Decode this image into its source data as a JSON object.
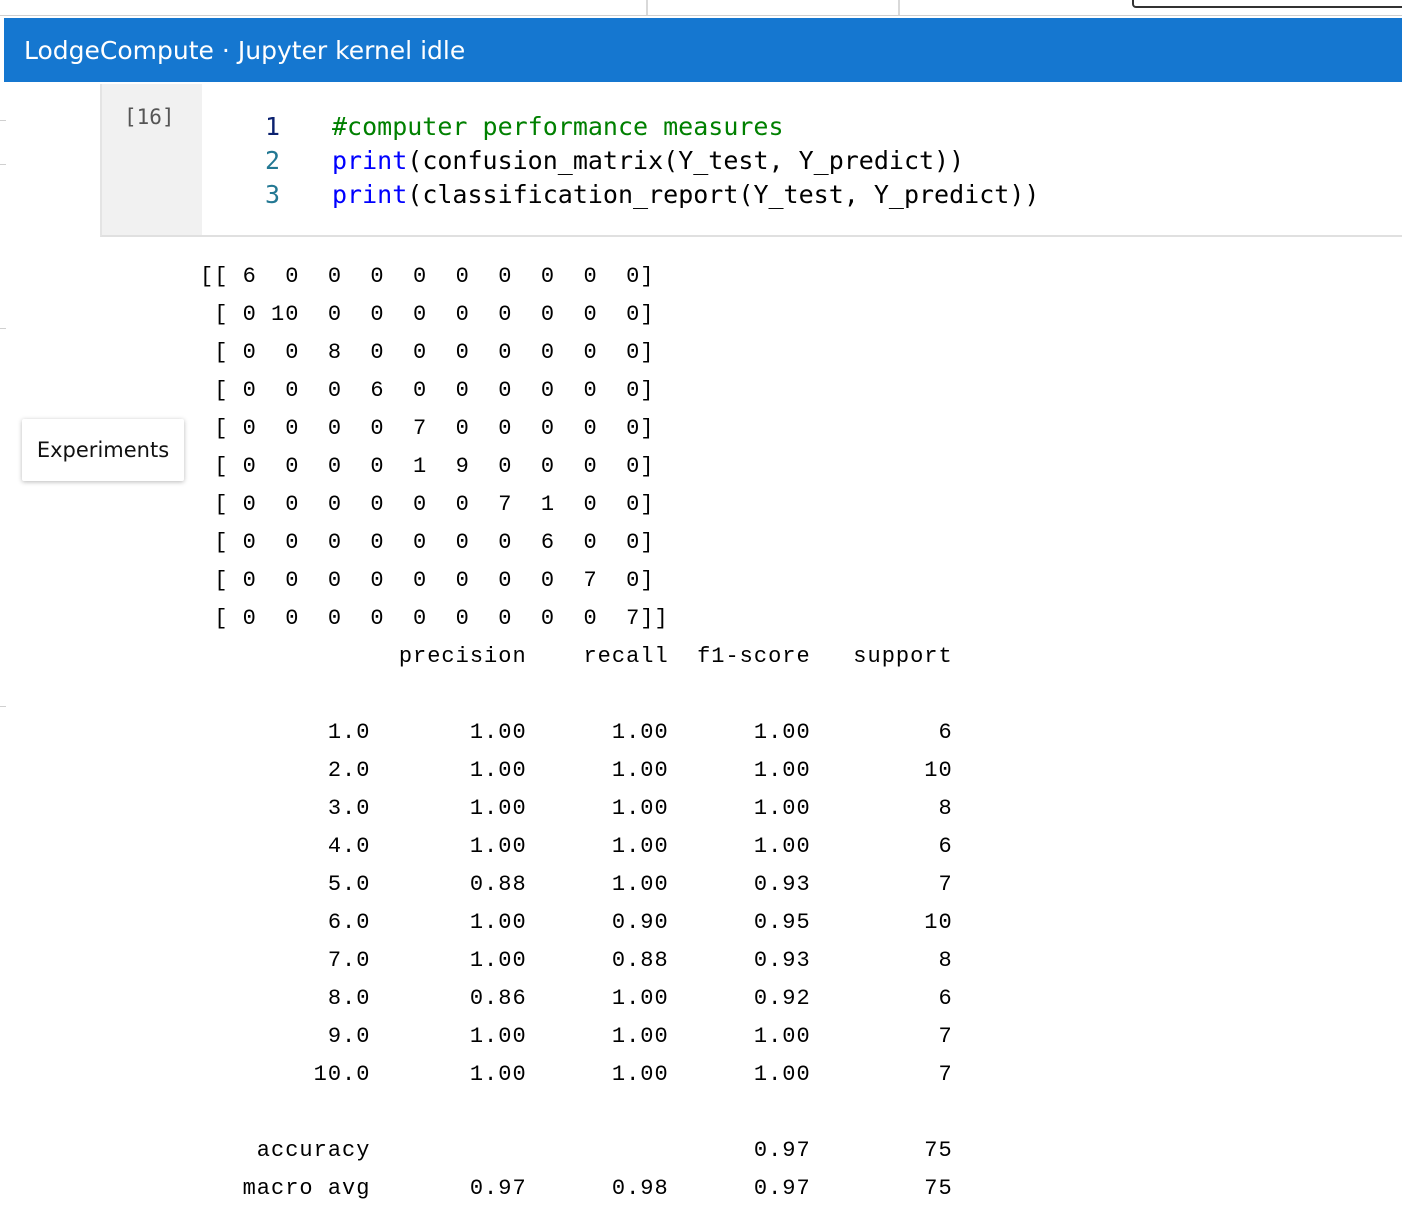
{
  "banner": {
    "app_name": "LodgeCompute",
    "separator": "·",
    "status": "Jupyter kernel idle"
  },
  "cell": {
    "execution_count": "[16]",
    "code_lines": [
      {
        "number": "1",
        "tokens": [
          {
            "text": "#computer performance measures",
            "kind": "comment"
          }
        ]
      },
      {
        "number": "2",
        "tokens": [
          {
            "text": "print",
            "kind": "func"
          },
          {
            "text": "(confusion_matrix(Y_test, Y_predict))",
            "kind": "text"
          }
        ]
      },
      {
        "number": "3",
        "tokens": [
          {
            "text": "print",
            "kind": "func"
          },
          {
            "text": "(classification_report(Y_test, Y_predict))",
            "kind": "text"
          }
        ]
      }
    ]
  },
  "output": {
    "lines": [
      "[[ 6  0  0  0  0  0  0  0  0  0]",
      " [ 0 10  0  0  0  0  0  0  0  0]",
      " [ 0  0  8  0  0  0  0  0  0  0]",
      " [ 0  0  0  6  0  0  0  0  0  0]",
      " [ 0  0  0  0  7  0  0  0  0  0]",
      " [ 0  0  0  0  1  9  0  0  0  0]",
      " [ 0  0  0  0  0  0  7  1  0  0]",
      " [ 0  0  0  0  0  0  0  6  0  0]",
      " [ 0  0  0  0  0  0  0  0  7  0]",
      " [ 0  0  0  0  0  0  0  0  0  7]]",
      "              precision    recall  f1-score   support",
      "",
      "         1.0       1.00      1.00      1.00         6",
      "         2.0       1.00      1.00      1.00        10",
      "         3.0       1.00      1.00      1.00         8",
      "         4.0       1.00      1.00      1.00         6",
      "         5.0       0.88      1.00      0.93         7",
      "         6.0       1.00      0.90      0.95        10",
      "         7.0       1.00      0.88      0.93         8",
      "         8.0       0.86      1.00      0.92         6",
      "         9.0       1.00      1.00      1.00         7",
      "        10.0       1.00      1.00      1.00         7",
      "",
      "    accuracy                           0.97        75",
      "   macro avg       0.97      0.98      0.97        75"
    ]
  },
  "floating": {
    "experiments_label": "Experiments"
  }
}
